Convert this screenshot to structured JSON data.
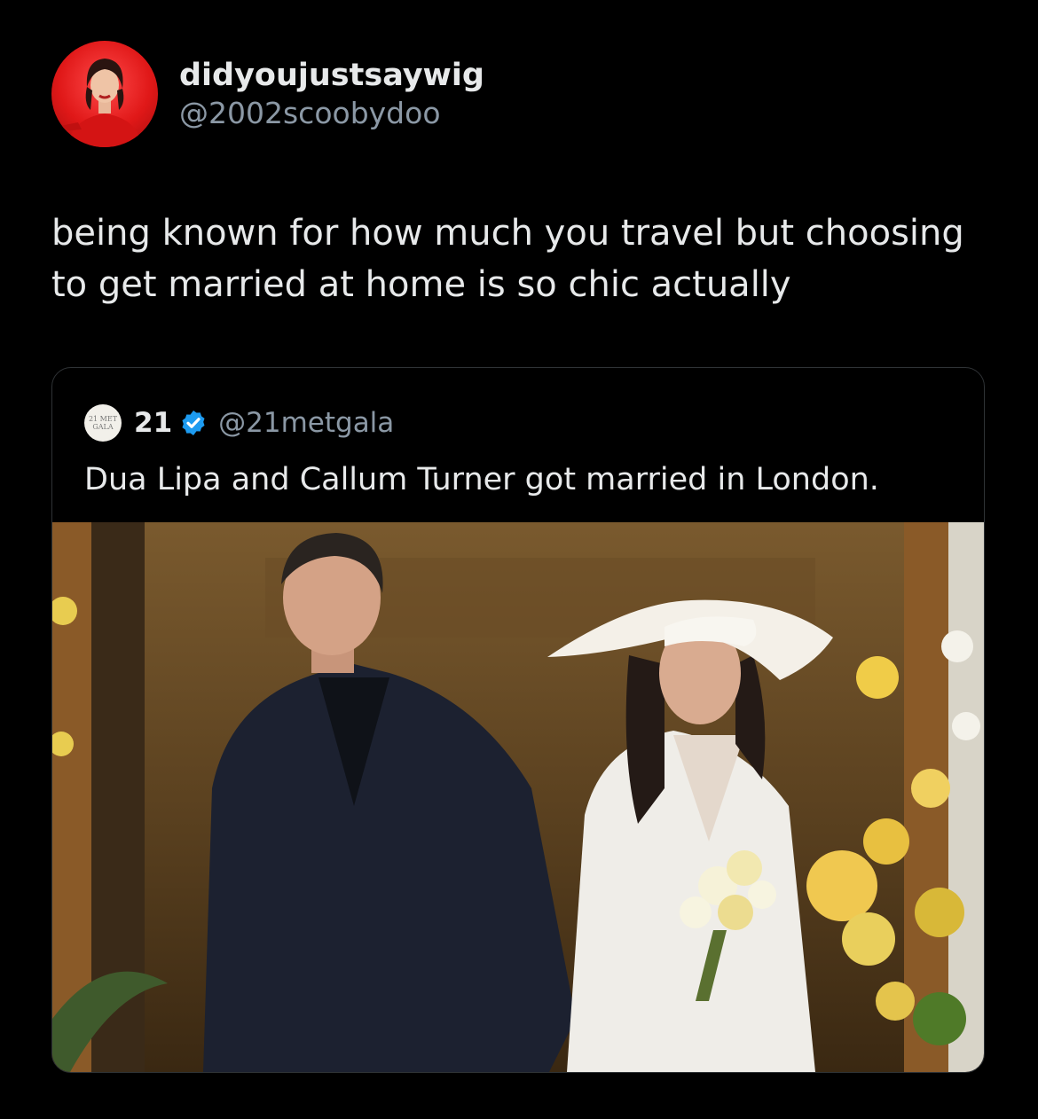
{
  "author": {
    "display_name": "didyoujustsaywig",
    "handle": "@2002scoobydoo",
    "avatar_icon": "profile-photo"
  },
  "tweet": {
    "text": "being known for how much you travel but choosing to get married at home is so chic actually"
  },
  "quoted_tweet": {
    "avatar_text": "21 MET GALA",
    "display_name": "21",
    "verified_icon": "verified-badge-icon",
    "handle": "@21metgala",
    "text": "Dua Lipa and Callum Turner got married in London.",
    "photo": "wedding-couple-photo"
  },
  "colors": {
    "background": "#000000",
    "primary_text": "#e7e9ea",
    "secondary_text": "#8b98a5",
    "verified": "#1d9bf0",
    "border": "#2f3336"
  }
}
